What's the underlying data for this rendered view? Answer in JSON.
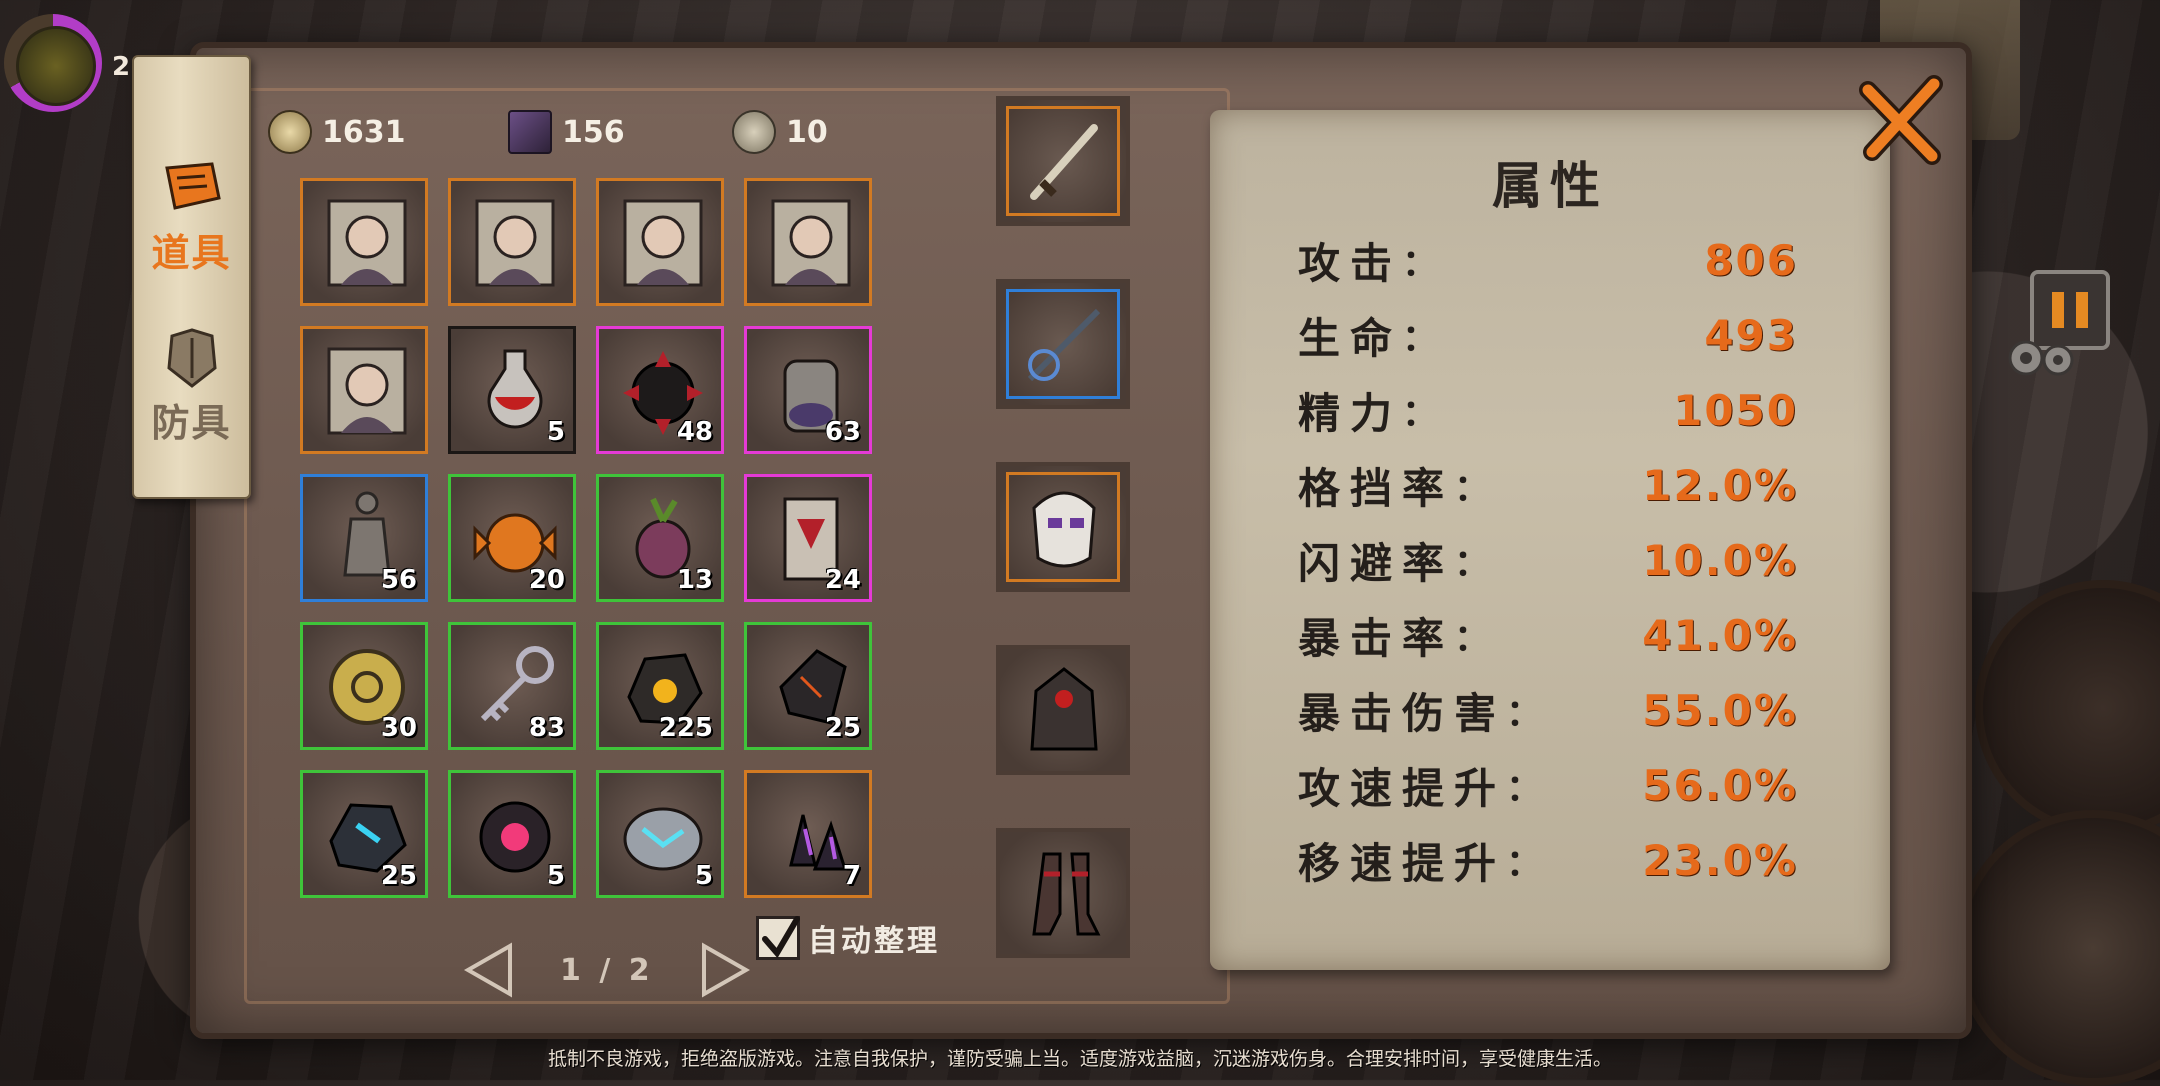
{
  "hud": {
    "level": "2"
  },
  "tabs": [
    {
      "label": "道具",
      "active": true
    },
    {
      "label": "防具",
      "active": false
    }
  ],
  "currencies": [
    {
      "icon": "gold-coin-icon",
      "value": "1631"
    },
    {
      "icon": "spellbook-icon",
      "value": "156"
    },
    {
      "icon": "token-icon",
      "value": "10"
    }
  ],
  "inventory": {
    "items": [
      {
        "icon": "hero-portrait-plague-doctor-icon",
        "rarity": "orange",
        "count": ""
      },
      {
        "icon": "hero-portrait-red-witch-icon",
        "rarity": "orange",
        "count": ""
      },
      {
        "icon": "hero-portrait-white-hair-girl-icon",
        "rarity": "orange",
        "count": ""
      },
      {
        "icon": "hero-portrait-white-hair-man-icon",
        "rarity": "orange",
        "count": ""
      },
      {
        "icon": "hero-portrait-silver-hair-icon",
        "rarity": "orange",
        "count": ""
      },
      {
        "icon": "red-potion-icon",
        "rarity": "black",
        "count": "5"
      },
      {
        "icon": "dark-spiked-orb-icon",
        "rarity": "magenta",
        "count": "48"
      },
      {
        "icon": "jar-of-berries-icon",
        "rarity": "magenta",
        "count": "63"
      },
      {
        "icon": "stone-statue-icon",
        "rarity": "blue",
        "count": "56"
      },
      {
        "icon": "pumpkin-candy-icon",
        "rarity": "green",
        "count": "20"
      },
      {
        "icon": "purple-radish-icon",
        "rarity": "green",
        "count": "13"
      },
      {
        "icon": "fox-banner-icon",
        "rarity": "magenta",
        "count": "24"
      },
      {
        "icon": "gold-gear-coin-icon",
        "rarity": "green",
        "count": "30"
      },
      {
        "icon": "silver-key-icon",
        "rarity": "green",
        "count": "83"
      },
      {
        "icon": "gold-ore-rock-icon",
        "rarity": "green",
        "count": "225"
      },
      {
        "icon": "obsidian-shard-icon",
        "rarity": "green",
        "count": "25"
      },
      {
        "icon": "blue-crystal-rock-icon",
        "rarity": "green",
        "count": "25"
      },
      {
        "icon": "pink-crystal-orb-icon",
        "rarity": "green",
        "count": "5"
      },
      {
        "icon": "cyan-crystal-stone-icon",
        "rarity": "green",
        "count": "5"
      },
      {
        "icon": "purple-crystal-shards-icon",
        "rarity": "orange",
        "count": "7"
      }
    ]
  },
  "auto_sort": {
    "label": "自动整理",
    "checked": true
  },
  "pager": {
    "current": "1",
    "total": "2",
    "text": "1 / 2"
  },
  "equipment": [
    {
      "icon": "curved-sword-icon",
      "frame": "orange"
    },
    {
      "icon": "anchor-staff-icon",
      "frame": "blue"
    },
    {
      "icon": "harlequin-mask-icon",
      "frame": "orange"
    },
    {
      "icon": "hooded-armor-icon",
      "frame": "none"
    },
    {
      "icon": "leather-boots-icon",
      "frame": "none"
    }
  ],
  "stats": {
    "title": "属性",
    "rows": [
      {
        "label": "攻击",
        "value": "806"
      },
      {
        "label": "生命",
        "value": "493"
      },
      {
        "label": "精力",
        "value": "1050"
      },
      {
        "label": "格挡率",
        "value": "12.0%"
      },
      {
        "label": "闪避率",
        "value": "10.0%"
      },
      {
        "label": "暴击率",
        "value": "41.0%"
      },
      {
        "label": "暴击伤害",
        "value": "55.0%"
      },
      {
        "label": "攻速提升",
        "value": "56.0%"
      },
      {
        "label": "移速提升",
        "value": "23.0%"
      }
    ]
  },
  "footer": "抵制不良游戏，拒绝盗版游戏。注意自我保护，谨防受骗上当。适度游戏益脑，沉迷游戏伤身。合理安排时间，享受健康生活。",
  "colors": {
    "accent": "#e66a1b",
    "rarity_orange": "#d27a22",
    "rarity_magenta": "#e53ad6",
    "rarity_green": "#3fc43a",
    "rarity_blue": "#2f7fd9"
  }
}
